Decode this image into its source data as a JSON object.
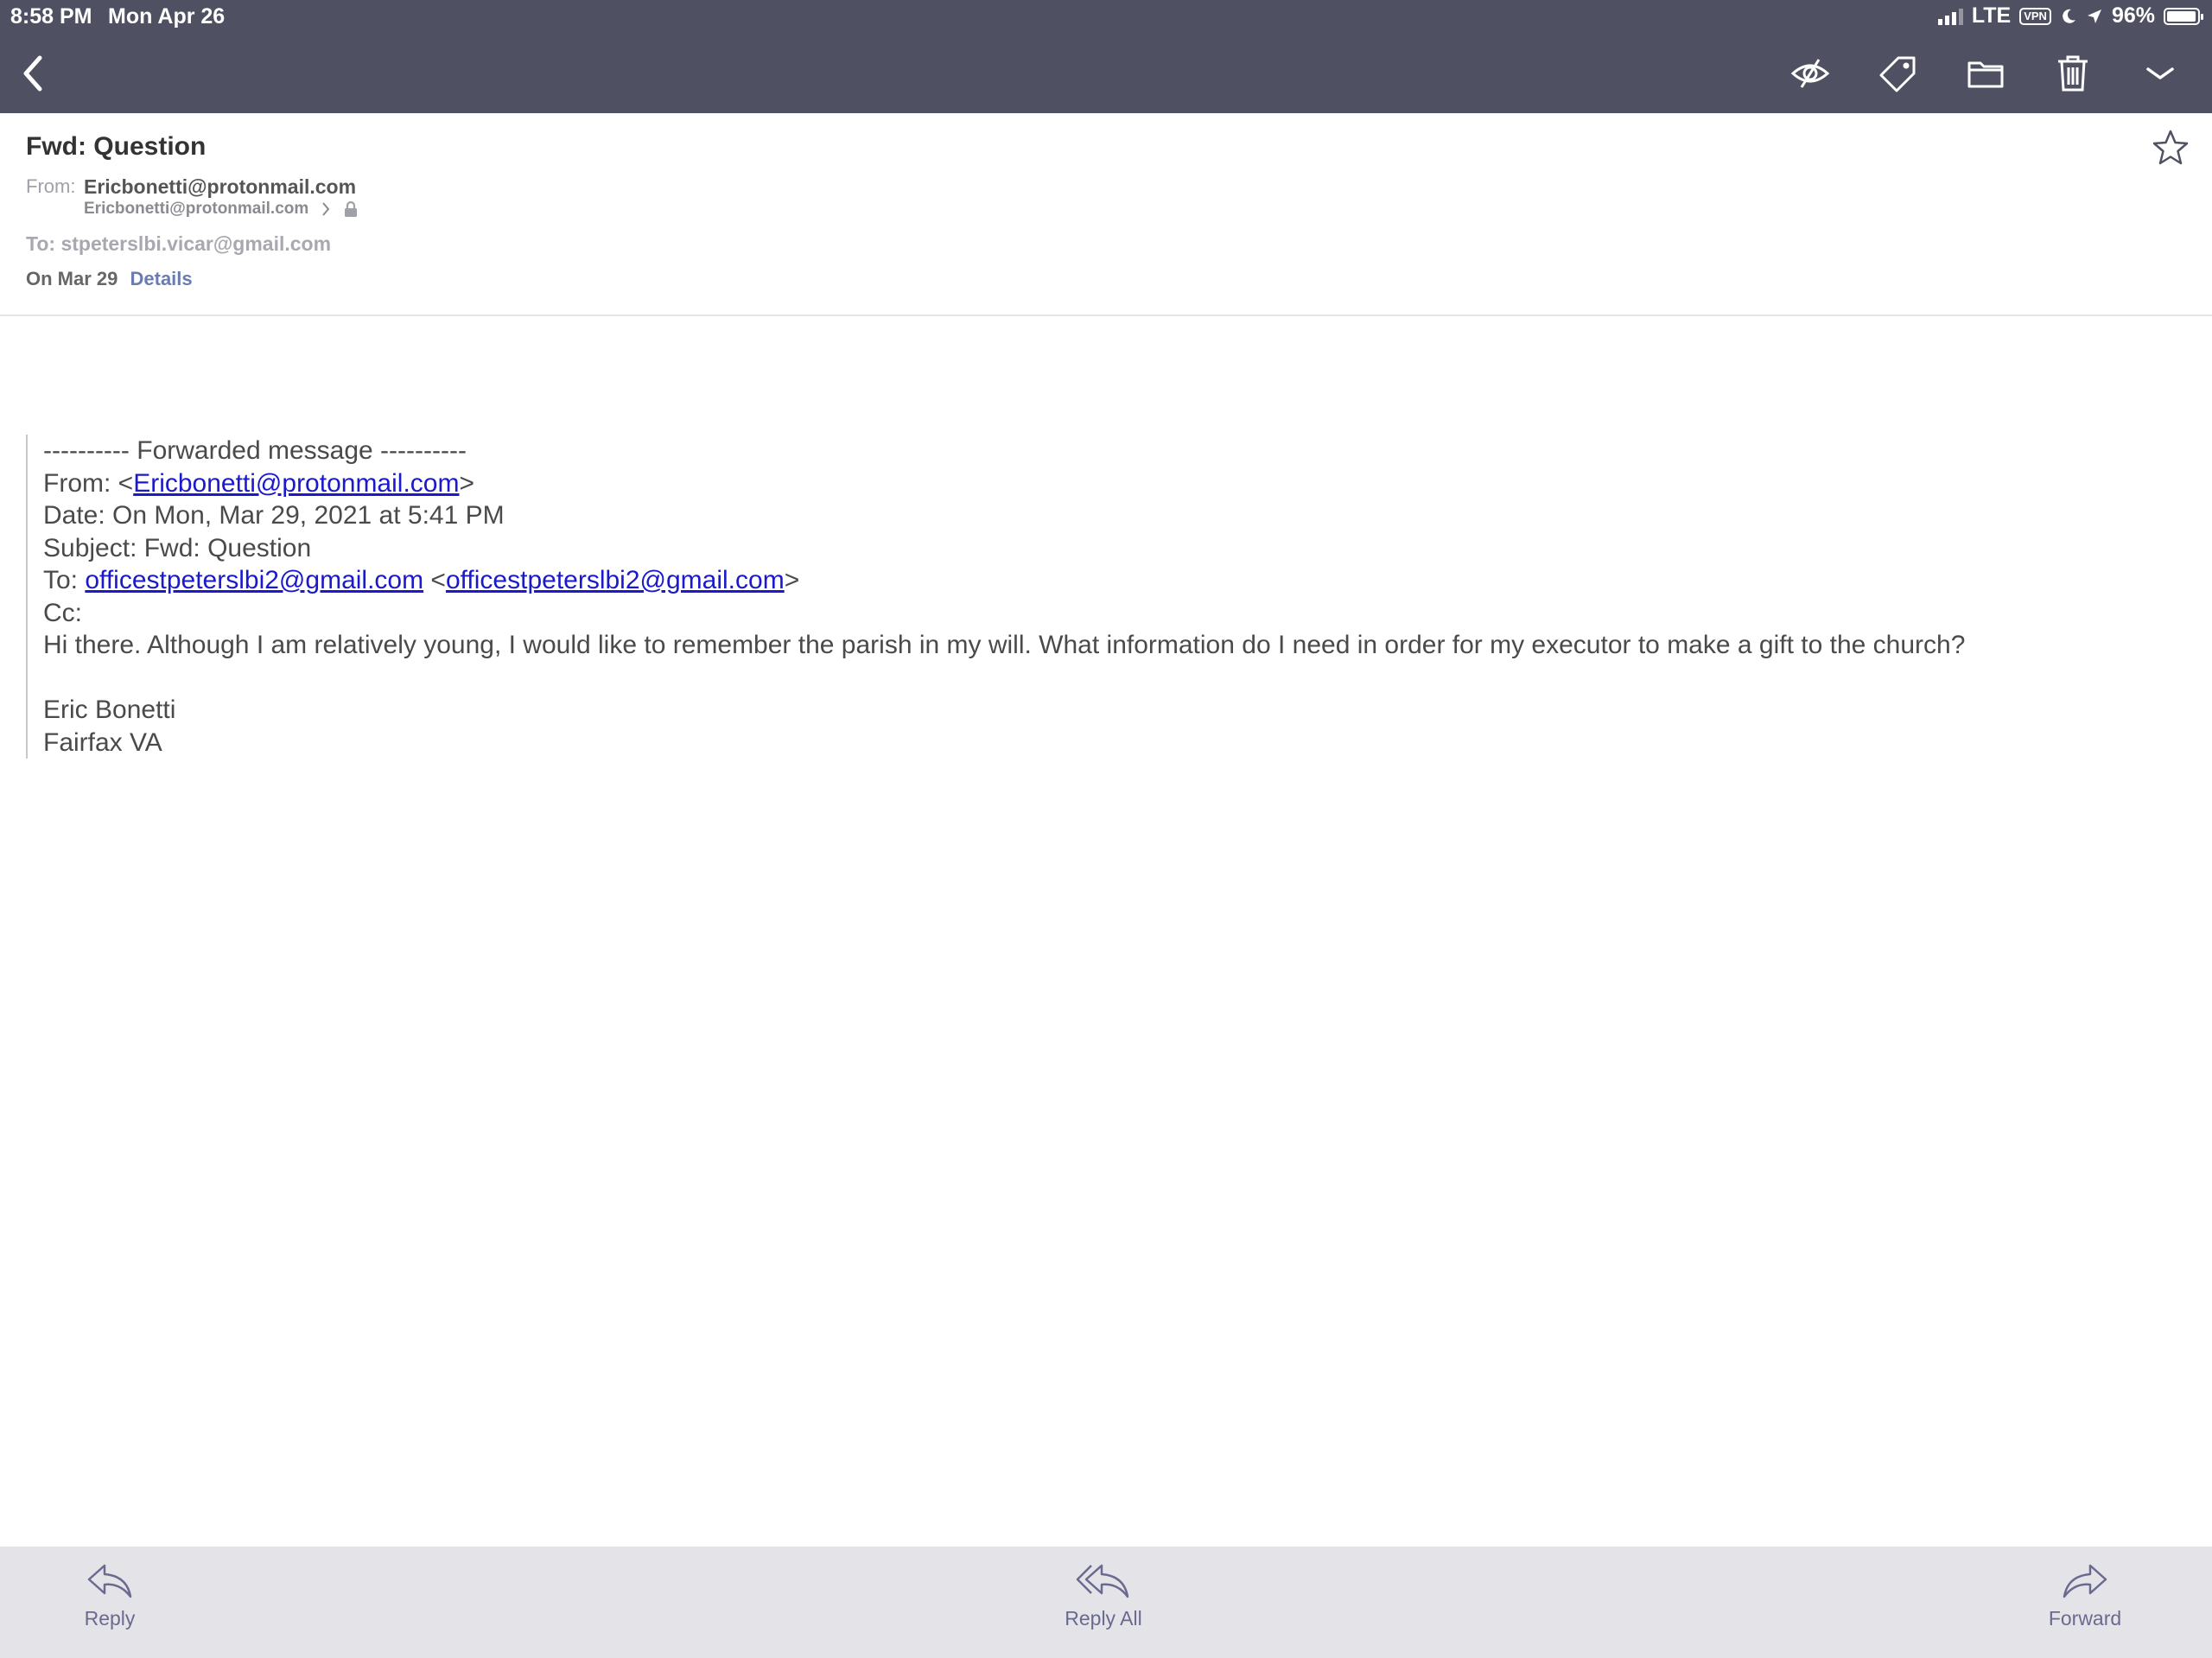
{
  "status_bar": {
    "time": "8:58 PM",
    "date": "Mon Apr 26",
    "network": "LTE",
    "vpn": "VPN",
    "battery": "96%",
    "battery_level": 0.96
  },
  "toolbar": {
    "back_icon": "chevron-left-icon",
    "actions": [
      "eye-slash-icon",
      "tag-icon",
      "folder-icon",
      "trash-icon",
      "chevron-down-icon"
    ]
  },
  "message": {
    "subject": "Fwd: Question",
    "from_label": "From:",
    "from_name": "Ericbonetti@protonmail.com",
    "from_address": "Ericbonetti@protonmail.com",
    "to_line": "To: stpeterslbi.vicar@gmail.com",
    "date": "On Mar 29",
    "details_link": "Details",
    "starred": false
  },
  "body": {
    "forward_header": "---------- Forwarded message ----------",
    "from_prefix": "From: <",
    "from_email": "Ericbonetti@protonmail.com",
    "from_suffix": ">",
    "date_line": "Date: On Mon, Mar 29, 2021 at 5:41 PM",
    "subject_line": "Subject: Fwd: Question",
    "to_prefix": "To: ",
    "to_email_1": "officestpeterslbi2@gmail.com",
    "to_mid": " <",
    "to_email_2": "officestpeterslbi2@gmail.com",
    "to_suffix": ">",
    "cc_line": "Cc:",
    "text": "Hi there. Although I am relatively young, I would like to remember the parish in my will. What information do I need in order for my executor to make a gift to the church?",
    "signature_name": "Eric Bonetti",
    "signature_location": "Fairfax VA"
  },
  "bottom_actions": {
    "reply": "Reply",
    "reply_all": "Reply All",
    "forward": "Forward"
  },
  "colors": {
    "toolbar_bg": "#4f5061",
    "link": "#1a1acc",
    "accent": "#6a7bb2",
    "bottom_bg": "#e4e4e8"
  }
}
